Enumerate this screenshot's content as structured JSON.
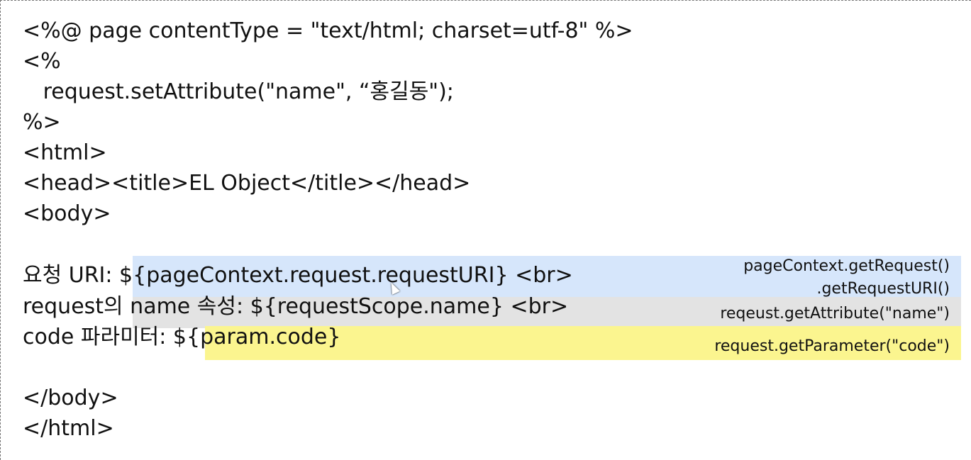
{
  "code_lines": [
    "<%@ page contentType = \"text/html; charset=utf-8\" %>",
    "<%",
    "   request.setAttribute(\"name\", “홍길동\");",
    "%>",
    "<html>",
    "<head><title>EL Object</title></head>",
    "<body>",
    "",
    "요청 URI: ${pageContext.request.requestURI} <br>",
    "request의 name 속성: ${requestScope.name} <br>",
    "code 파라미터: ${param.code}",
    "",
    "</body>",
    "</html>"
  ],
  "annotations": {
    "request_uri_line1": "pageContext.getRequest()",
    "request_uri_line2": ".getRequestURI()",
    "request_scope": "reqeust.getAttribute(\"name\")",
    "param": "request.getParameter(\"code\")"
  },
  "colors": {
    "highlight_blue": "#d6e6fb",
    "highlight_gray": "#e3e3e3",
    "highlight_yellow": "#fbf58f"
  }
}
